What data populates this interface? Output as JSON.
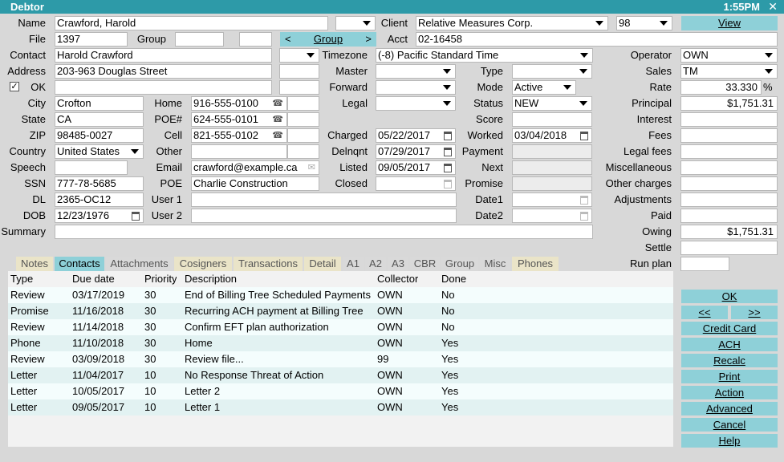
{
  "window": {
    "title": "Debtor",
    "time": "1:55PM",
    "close": "✕"
  },
  "labels": {
    "name": "Name",
    "file": "File",
    "group": "Group",
    "contact": "Contact",
    "address": "Address",
    "ok": "OK",
    "city": "City",
    "state": "State",
    "zip": "ZIP",
    "country": "Country",
    "speech": "Speech",
    "ssn": "SSN",
    "dl": "DL",
    "dob": "DOB",
    "summary": "Summary",
    "home": "Home",
    "poe_num": "POE#",
    "cell": "Cell",
    "other": "Other",
    "email": "Email",
    "poe": "POE",
    "user1": "User 1",
    "user2": "User 2",
    "client": "Client",
    "acct": "Acct",
    "timezone": "Timezone",
    "master": "Master",
    "forward": "Forward",
    "legal": "Legal",
    "charged": "Charged",
    "delnqnt": "Delnqnt",
    "listed": "Listed",
    "closed": "Closed",
    "type": "Type",
    "mode": "Mode",
    "status": "Status",
    "score": "Score",
    "worked": "Worked",
    "payment": "Payment",
    "next": "Next",
    "promise": "Promise",
    "date1": "Date1",
    "date2": "Date2",
    "operator": "Operator",
    "sales": "Sales",
    "rate": "Rate",
    "principal": "Principal",
    "interest": "Interest",
    "fees": "Fees",
    "legal_fees": "Legal fees",
    "miscellaneous": "Miscellaneous",
    "other_charges": "Other charges",
    "adjustments": "Adjustments",
    "paid": "Paid",
    "owing": "Owing",
    "settle": "Settle",
    "run_plan": "Run plan",
    "percent": "%"
  },
  "values": {
    "name": "Crawford, Harold",
    "file": "1397",
    "contact": "Harold Crawford",
    "address": "203-963 Douglas Street",
    "ok_checked": "✓",
    "city": "Crofton",
    "state": "CA",
    "zip": "98485-0027",
    "country": "United States",
    "ssn": "777-78-5685",
    "dl": "2365-OC12",
    "dob": "12/23/1976",
    "home": "916-555-0100",
    "poe_num": "624-555-0101",
    "cell": "821-555-0102",
    "email": "crawford@example.ca",
    "poe": "Charlie Construction",
    "client": "Relative Measures Corp.",
    "client_code": "98",
    "acct": "02-16458",
    "timezone": "(-8) Pacific Standard Time",
    "charged": "05/22/2017",
    "delnqnt": "07/29/2017",
    "listed": "09/05/2017",
    "mode": "Active",
    "status": "NEW",
    "worked": "03/04/2018",
    "operator": "OWN",
    "sales": "TM",
    "rate": "33.330",
    "principal": "$1,751.31",
    "owing": "$1,751.31"
  },
  "buttons": {
    "group_prev": "<",
    "group": "Group",
    "group_next": ">",
    "view": "View",
    "ok": "OK",
    "prev": "<<",
    "next": ">>",
    "credit_card": "Credit Card",
    "ach": "ACH",
    "recalc": "Recalc",
    "print": "Print",
    "action": "Action",
    "advanced": "Advanced",
    "cancel": "Cancel",
    "help": "Help"
  },
  "tabs": [
    "Notes",
    "Contacts",
    "Attachments",
    "Cosigners",
    "Transactions",
    "Detail",
    "A1",
    "A2",
    "A3",
    "CBR",
    "Group",
    "Misc",
    "Phones"
  ],
  "table": {
    "columns": [
      "Type",
      "Due date",
      "Priority",
      "Description",
      "Collector",
      "Done"
    ],
    "rows": [
      [
        "Review",
        "03/17/2019",
        "30",
        "End of Billing Tree Scheduled Payments",
        "OWN",
        "No"
      ],
      [
        "Promise",
        "11/16/2018",
        "30",
        "Recurring ACH payment at Billing Tree",
        "OWN",
        "No"
      ],
      [
        "Review",
        "11/14/2018",
        "30",
        "Confirm EFT plan authorization",
        "OWN",
        "No"
      ],
      [
        "Phone",
        "11/10/2018",
        "30",
        "Home",
        "OWN",
        "Yes"
      ],
      [
        "Review",
        "03/09/2018",
        "30",
        "Review file...",
        "99",
        "Yes"
      ],
      [
        "Letter",
        "11/04/2017",
        "10",
        "No Response Threat of Action",
        "OWN",
        "Yes"
      ],
      [
        "Letter",
        "10/05/2017",
        "10",
        "Letter 2",
        "OWN",
        "Yes"
      ],
      [
        "Letter",
        "09/05/2017",
        "10",
        "Letter 1",
        "OWN",
        "Yes"
      ]
    ]
  },
  "icons": {
    "phone": "phone-icon",
    "email": "email-icon",
    "calendar": "calendar-icon",
    "dropdown": "chevron-down-icon"
  },
  "colors": {
    "title_bar": "#2d9aa8",
    "button": "#8ed0d8",
    "tab_active": "#8ed0d8",
    "tab_inactive": "#eae4c8"
  }
}
